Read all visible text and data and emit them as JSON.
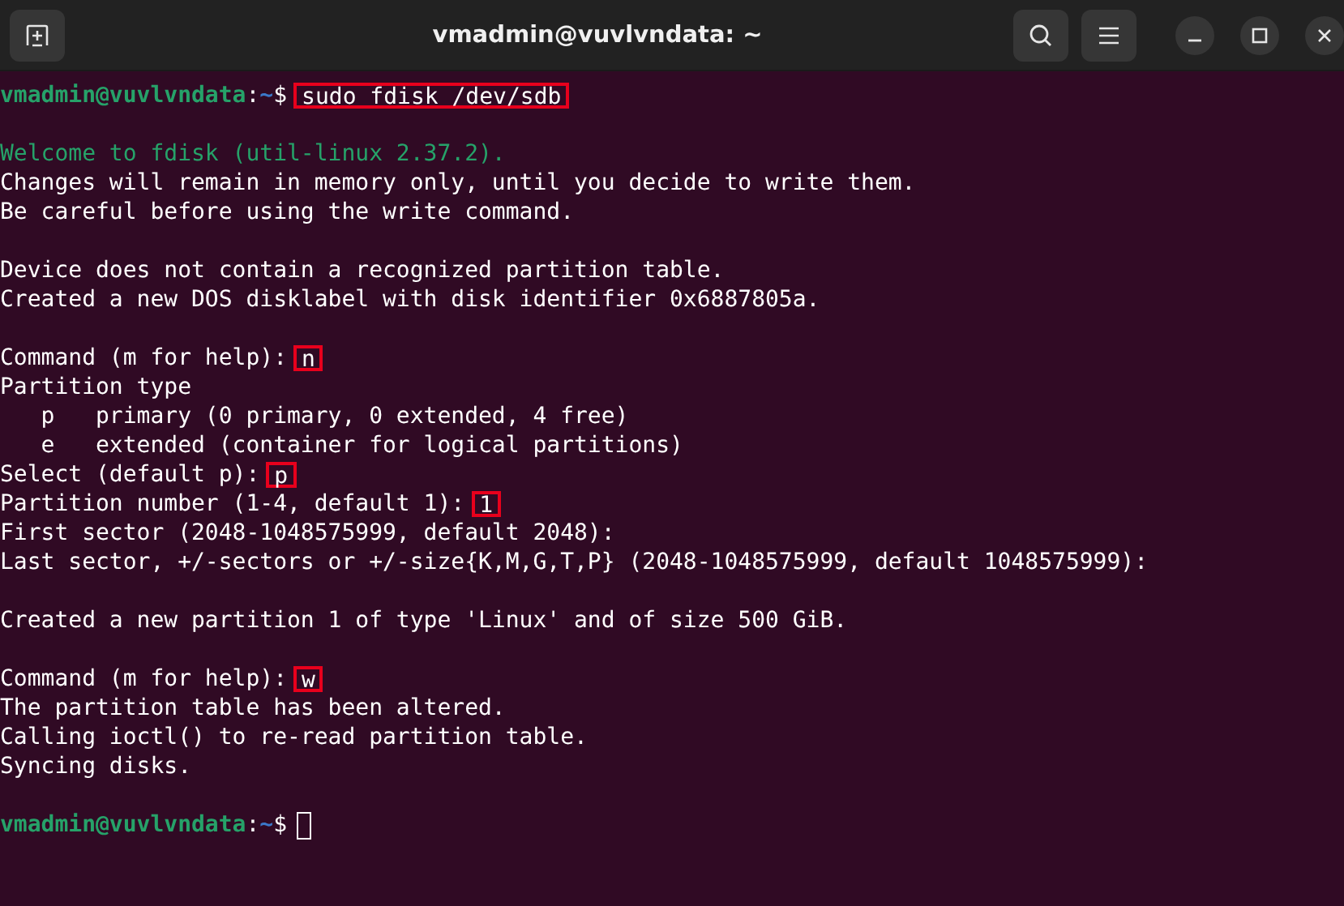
{
  "window": {
    "title": "vmadmin@vuvlvndata: ~"
  },
  "terminal": {
    "lines": [
      {
        "kind": "prompt",
        "prompt": {
          "user": "vmadmin@vuvlvndata",
          "separator": ":",
          "path": "~",
          "symbol": "$"
        },
        "input": "sudo fdisk /dev/sdb",
        "marked": true
      },
      {
        "kind": "blank"
      },
      {
        "kind": "info",
        "text": "Welcome to fdisk (util-linux 2.37.2)."
      },
      {
        "kind": "output",
        "text": "Changes will remain in memory only, until you decide to write them."
      },
      {
        "kind": "output",
        "text": "Be careful before using the write command."
      },
      {
        "kind": "blank"
      },
      {
        "kind": "output",
        "text": "Device does not contain a recognized partition table."
      },
      {
        "kind": "output",
        "text": "Created a new DOS disklabel with disk identifier 0x6887805a."
      },
      {
        "kind": "blank"
      },
      {
        "kind": "question",
        "text": "Command (m for help):",
        "input": "n",
        "marked": true
      },
      {
        "kind": "output",
        "text": "Partition type"
      },
      {
        "kind": "output",
        "text": "   p   primary (0 primary, 0 extended, 4 free)"
      },
      {
        "kind": "output",
        "text": "   e   extended (container for logical partitions)"
      },
      {
        "kind": "question",
        "text": "Select (default p):",
        "input": "p",
        "marked": true
      },
      {
        "kind": "question",
        "text": "Partition number (1-4, default 1):",
        "input": "1",
        "marked": true
      },
      {
        "kind": "output",
        "text": "First sector (2048-1048575999, default 2048):"
      },
      {
        "kind": "output",
        "text": "Last sector, +/-sectors or +/-size{K,M,G,T,P} (2048-1048575999, default 1048575999):"
      },
      {
        "kind": "blank"
      },
      {
        "kind": "output",
        "text": "Created a new partition 1 of type 'Linux' and of size 500 GiB."
      },
      {
        "kind": "blank"
      },
      {
        "kind": "question",
        "text": "Command (m for help):",
        "input": "w",
        "marked": true
      },
      {
        "kind": "output",
        "text": "The partition table has been altered."
      },
      {
        "kind": "output",
        "text": "Calling ioctl() to re-read partition table."
      },
      {
        "kind": "output",
        "text": "Syncing disks."
      },
      {
        "kind": "blank"
      },
      {
        "kind": "prompt",
        "prompt": {
          "user": "vmadmin@vuvlvndata",
          "separator": ":",
          "path": "~",
          "symbol": "$"
        },
        "cursor": true
      }
    ]
  }
}
